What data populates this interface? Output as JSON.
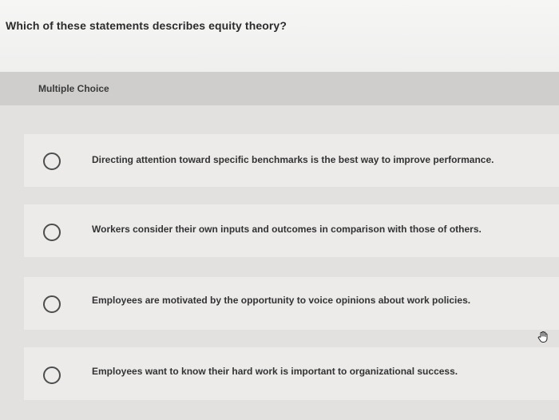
{
  "question": {
    "text": "Which of these statements describes equity theory?"
  },
  "section": {
    "label": "Multiple Choice"
  },
  "choices": [
    {
      "text": "Directing attention toward specific benchmarks is the best way to improve performance."
    },
    {
      "text": "Workers consider their own inputs and outcomes in comparison with those of others."
    },
    {
      "text": "Employees are motivated by the opportunity to voice opinions about work policies."
    },
    {
      "text": "Employees want to know their hard work is important to organizational success."
    }
  ],
  "icons": {
    "radio": "radio-unselected-icon",
    "cursor": "hand-pointer-icon"
  }
}
